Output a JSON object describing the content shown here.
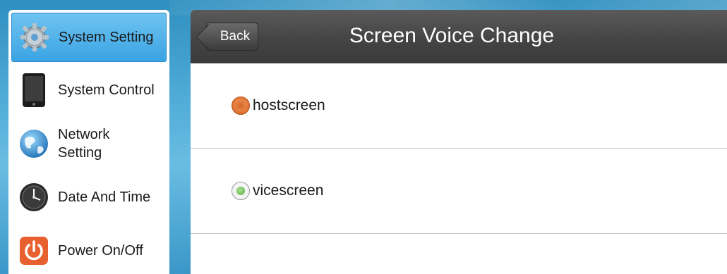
{
  "sidebar": {
    "items": [
      {
        "label": "System Setting",
        "icon": "gear-icon",
        "active": true
      },
      {
        "label": "System Control",
        "icon": "tablet-icon",
        "active": false
      },
      {
        "label": "Network Setting",
        "icon": "globe-icon",
        "active": false
      },
      {
        "label": "Date And Time",
        "icon": "clock-icon",
        "active": false
      },
      {
        "label": "Power On/Off",
        "icon": "power-icon",
        "active": false
      }
    ]
  },
  "header": {
    "back_label": "Back",
    "title": "Screen Voice Change"
  },
  "options": [
    {
      "label": "hostscreen",
      "selected": true
    },
    {
      "label": "vicescreen",
      "selected": false
    }
  ],
  "colors": {
    "active_item": "#3aa4e4",
    "header_bg": "#444444",
    "selected_radio": "#e5793a",
    "unselected_dot": "#5cae44"
  }
}
